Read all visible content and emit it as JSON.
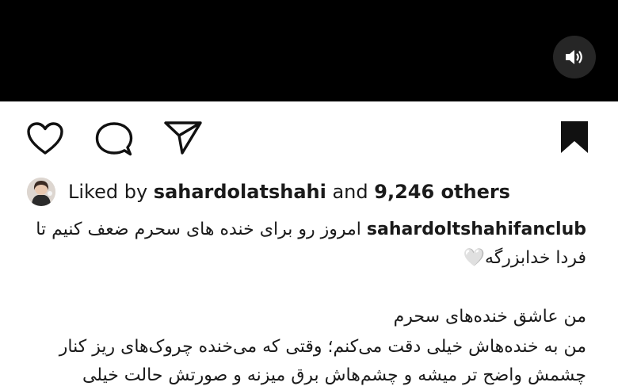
{
  "video": {
    "mute_icon": "speaker-icon"
  },
  "actions": {
    "like_icon": "heart-icon",
    "comment_icon": "comment-icon",
    "share_icon": "send-icon",
    "save_icon": "bookmark-icon"
  },
  "likes": {
    "prefix": "Liked by ",
    "user": "sahardolatshahi",
    "middle": " and ",
    "count": "9,246 others"
  },
  "caption": {
    "username": "sahardoltshahifanclub",
    "line1": "امروز رو برای خنده های سحرم ضعف کنیم تا",
    "line2": "فردا خدابزرگه🤍",
    "line3": "من عاشق خنده‌های سحرم",
    "line4": "من به خنده‌هاش خیلی دقت می‌کنم؛ وقتی که می‌خنده چروک‌های ریز کنار",
    "line5": "چشمش واضح تر میشه و چشم‌هاش برق میزنه و صورتش حالت خیلی"
  }
}
